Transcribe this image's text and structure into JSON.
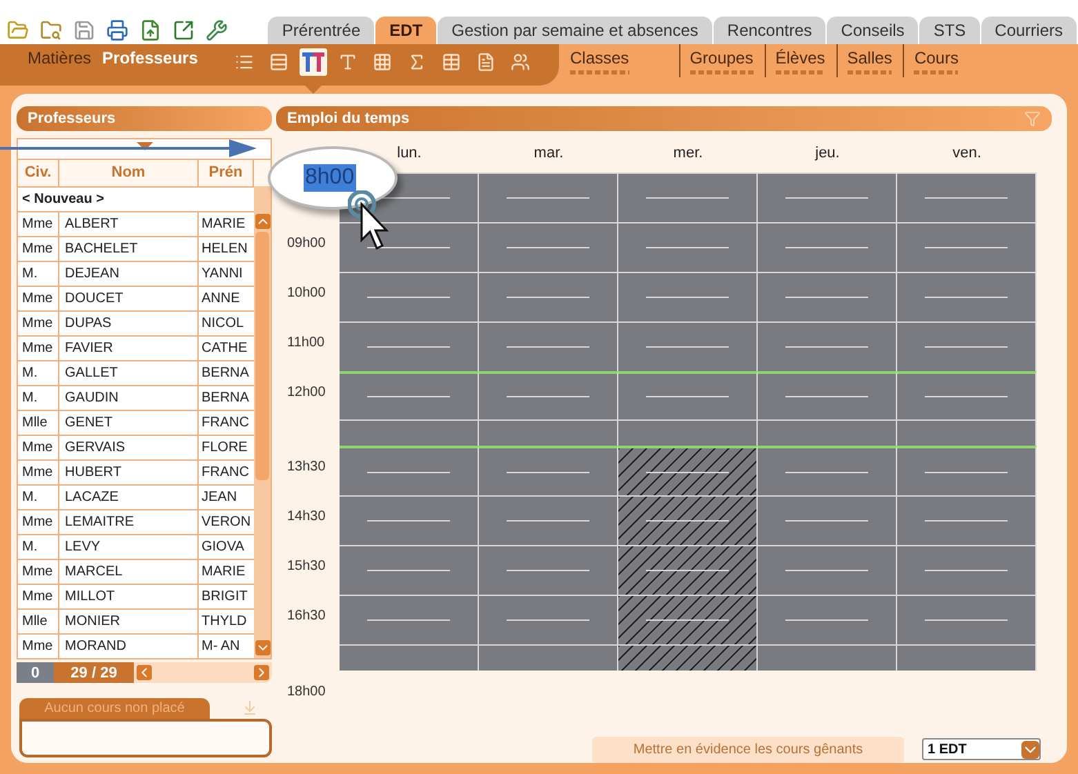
{
  "top_tabs": [
    {
      "label": "Prérentrée",
      "selected": false
    },
    {
      "label": "EDT",
      "selected": true
    },
    {
      "label": "Gestion par semaine et absences",
      "selected": false
    },
    {
      "label": "Rencontres",
      "selected": false
    },
    {
      "label": "Conseils",
      "selected": false
    },
    {
      "label": "STS",
      "selected": false
    },
    {
      "label": "Courriers",
      "selected": false
    }
  ],
  "left_tabs": [
    {
      "label": "Matières",
      "selected": false
    },
    {
      "label": "Professeurs",
      "selected": true
    }
  ],
  "view_buttons": [
    {
      "kind": "list",
      "selected": false
    },
    {
      "kind": "stack",
      "selected": false
    },
    {
      "kind": "tt",
      "selected": true
    },
    {
      "kind": "t",
      "selected": false
    },
    {
      "kind": "grid",
      "selected": false
    },
    {
      "kind": "sigma",
      "selected": false
    },
    {
      "kind": "table",
      "selected": false
    },
    {
      "kind": "form",
      "selected": false
    },
    {
      "kind": "people",
      "selected": false
    }
  ],
  "right_tabs": [
    {
      "label": "Classes",
      "selected": false
    },
    {
      "label": "Groupes",
      "selected": false
    },
    {
      "label": "Élèves",
      "selected": false
    },
    {
      "label": "Salles",
      "selected": false
    },
    {
      "label": "Cours",
      "selected": false
    }
  ],
  "professeurs": {
    "title": "Professeurs",
    "columns": [
      "Civ.",
      "Nom",
      "Prén"
    ],
    "new_row": "< Nouveau >",
    "rows": [
      {
        "civ": "Mme",
        "nom": "ALBERT",
        "prenom": "MARIE"
      },
      {
        "civ": "Mme",
        "nom": "BACHELET",
        "prenom": "HELEN"
      },
      {
        "civ": "M.",
        "nom": "DEJEAN",
        "prenom": "YANNI"
      },
      {
        "civ": "Mme",
        "nom": "DOUCET",
        "prenom": "ANNE"
      },
      {
        "civ": "Mme",
        "nom": "DUPAS",
        "prenom": "NICOL"
      },
      {
        "civ": "Mme",
        "nom": "FAVIER",
        "prenom": "CATHE"
      },
      {
        "civ": "M.",
        "nom": "GALLET",
        "prenom": "BERNA"
      },
      {
        "civ": "M.",
        "nom": "GAUDIN",
        "prenom": "BERNA"
      },
      {
        "civ": "Mlle",
        "nom": "GENET",
        "prenom": "FRANC"
      },
      {
        "civ": "Mme",
        "nom": "GERVAIS",
        "prenom": "FLORE"
      },
      {
        "civ": "Mme",
        "nom": "HUBERT",
        "prenom": "FRANC"
      },
      {
        "civ": "M.",
        "nom": "LACAZE",
        "prenom": "JEAN"
      },
      {
        "civ": "Mme",
        "nom": "LEMAITRE",
        "prenom": "VERON"
      },
      {
        "civ": "M.",
        "nom": "LEVY",
        "prenom": "GIOVA"
      },
      {
        "civ": "Mme",
        "nom": "MARCEL",
        "prenom": "MARIE"
      },
      {
        "civ": "Mme",
        "nom": "MILLOT",
        "prenom": "BRIGIT"
      },
      {
        "civ": "Mlle",
        "nom": "MONIER",
        "prenom": "THYLD"
      },
      {
        "civ": "Mme",
        "nom": "MORAND",
        "prenom": "M- AN"
      }
    ],
    "selected_count": "0",
    "count": "29 / 29"
  },
  "non_place": {
    "title": "Aucun cours non placé"
  },
  "schedule": {
    "title": "Emploi du temps",
    "magnified_time": "8h00",
    "days": [
      {
        "label": "lun.",
        "hatched_after_pause": false
      },
      {
        "label": "mar.",
        "hatched_after_pause": false
      },
      {
        "label": "mer.",
        "hatched_after_pause": true
      },
      {
        "label": "jeu.",
        "hatched_after_pause": false
      },
      {
        "label": "ven.",
        "hatched_after_pause": false
      }
    ],
    "rows": [
      {
        "kind": "hour",
        "after_pause": false
      },
      {
        "kind": "hour",
        "start_label": "09h00",
        "after_pause": false
      },
      {
        "kind": "hour",
        "start_label": "10h00",
        "after_pause": false
      },
      {
        "kind": "hour",
        "start_label": "11h00",
        "after_pause": false
      },
      {
        "kind": "hour",
        "start_label": "12h00",
        "pause_start": true,
        "after_pause": false
      },
      {
        "kind": "half",
        "after_pause": false
      },
      {
        "kind": "hour",
        "start_label": "13h30",
        "pause_end": true,
        "after_pause": true
      },
      {
        "kind": "hour",
        "start_label": "14h30",
        "after_pause": true
      },
      {
        "kind": "hour",
        "start_label": "15h30",
        "after_pause": true
      },
      {
        "kind": "hour",
        "start_label": "16h30",
        "after_pause": true
      },
      {
        "kind": "half",
        "after_pause": true
      }
    ],
    "end_label": "18h00"
  },
  "highlight_button": {
    "label": "Mettre en évidence les cours gênants",
    "disabled": true
  },
  "edt_select": {
    "value": "1 EDT"
  }
}
